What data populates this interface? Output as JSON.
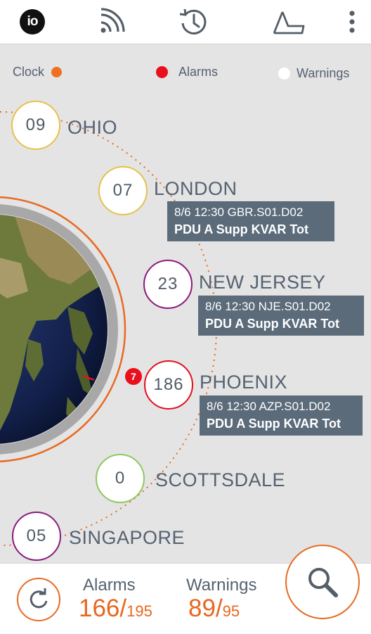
{
  "header": {
    "logo_text": "io",
    "icons": [
      "rss-feed-icon",
      "history-icon",
      "sensor-icon",
      "more-vertical-icon"
    ]
  },
  "legend": {
    "clock": {
      "label": "Clock",
      "color": "#f07020"
    },
    "alarms": {
      "label": "Alarms",
      "color": "#e8101c"
    },
    "warnings": {
      "label": "Warnings",
      "color": "#ffffff"
    }
  },
  "sites": [
    {
      "name": "OHIO",
      "count": "09",
      "ring_color": "#e8c04a"
    },
    {
      "name": "LONDON",
      "count": "07",
      "ring_color": "#e8c04a",
      "event": {
        "line1": "8/6 12:30  GBR.S01.D02",
        "line2": "PDU A  Supp KVAR Tot"
      }
    },
    {
      "name": "NEW JERSEY",
      "count": "23",
      "ring_color": "#8a1a7a",
      "event": {
        "line1": "8/6 12:30  NJE.S01.D02",
        "line2": "PDU A  Supp KVAR Tot"
      }
    },
    {
      "name": "PHOENIX",
      "count": "186",
      "ring_color": "#e01020",
      "badge": "7",
      "event": {
        "line1": "8/6 12:30  AZP.S01.D02",
        "line2": "PDU A  Supp KVAR Tot"
      }
    },
    {
      "name": "SCOTTSDALE",
      "count": "0",
      "ring_color": "#8cc860"
    },
    {
      "name": "SINGAPORE",
      "count": "05",
      "ring_color": "#8a1a7a"
    }
  ],
  "footer": {
    "alarms_label": "Alarms",
    "alarms_active": "166",
    "alarms_total": "195",
    "warnings_label": "Warnings",
    "warnings_active": "89",
    "warnings_total": "95",
    "separator": "/"
  },
  "colors": {
    "accent": "#e8661e",
    "info_bg": "#5b6b7a",
    "text": "#556272"
  }
}
